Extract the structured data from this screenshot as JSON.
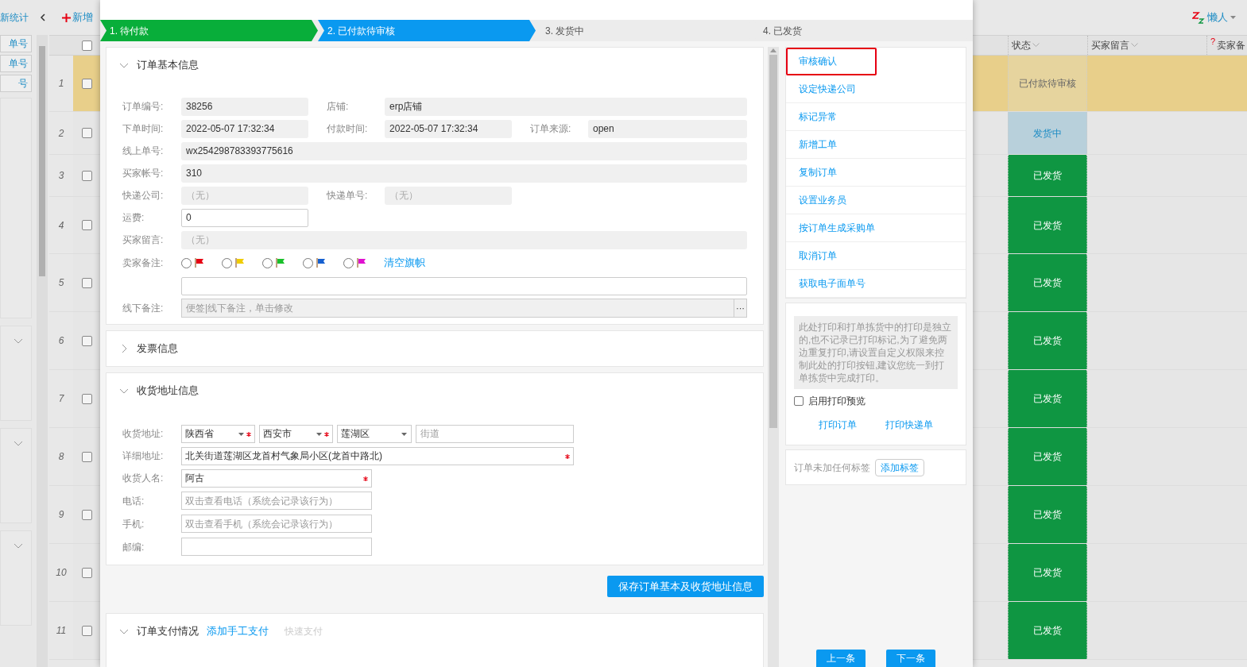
{
  "sidebar": {
    "title": "新统计",
    "fields": [
      "单号",
      "单号",
      "号"
    ]
  },
  "toolbar": {
    "add_button": "新增",
    "lazy_menu": "懒人"
  },
  "table": {
    "all_checked": false,
    "columns": [
      {
        "label": "状态"
      },
      {
        "label": "买家留言"
      },
      {
        "label": "卖家备",
        "help": "?"
      }
    ],
    "rows": [
      {
        "number": "1",
        "selected": true,
        "checked": false,
        "status": "已付款待审核",
        "kind": "pending"
      },
      {
        "number": "2",
        "selected": false,
        "checked": false,
        "status": "发货中",
        "kind": "shipping"
      },
      {
        "number": "3",
        "selected": false,
        "checked": false,
        "status": "已发货",
        "kind": "shipped"
      },
      {
        "number": "4",
        "selected": false,
        "checked": false,
        "status": "已发货",
        "kind": "shipped"
      },
      {
        "number": "5",
        "selected": false,
        "checked": false,
        "status": "已发货",
        "kind": "shipped"
      },
      {
        "number": "6",
        "selected": false,
        "checked": false,
        "status": "已发货",
        "kind": "shipped"
      },
      {
        "number": "7",
        "selected": false,
        "checked": false,
        "status": "已发货",
        "kind": "shipped"
      },
      {
        "number": "8",
        "selected": false,
        "checked": false,
        "status": "已发货",
        "kind": "shipped"
      },
      {
        "number": "9",
        "selected": false,
        "checked": false,
        "status": "已发货",
        "kind": "shipped"
      },
      {
        "number": "10",
        "selected": false,
        "checked": false,
        "status": "已发货",
        "kind": "shipped"
      },
      {
        "number": "11",
        "selected": false,
        "checked": false,
        "status": "已发货",
        "kind": "shipped"
      }
    ]
  },
  "modal": {
    "steps": [
      {
        "label": "1. 待付款",
        "kind": "done"
      },
      {
        "label": "2. 已付款待审核",
        "kind": "current"
      },
      {
        "label": "3. 发货中",
        "kind": "todo"
      },
      {
        "label": "4. 已发货",
        "kind": "todo"
      }
    ],
    "basic_info": {
      "title": "订单基本信息",
      "expanded": true,
      "order_no": {
        "label": "订单编号:",
        "value": "38256"
      },
      "shop": {
        "label": "店铺:",
        "value": "erp店铺"
      },
      "order_time": {
        "label": "下单时间:",
        "value": "2022-05-07 17:32:34"
      },
      "pay_time": {
        "label": "付款时间:",
        "value": "2022-05-07 17:32:34"
      },
      "source": {
        "label": "订单来源:",
        "value": "open"
      },
      "online_no": {
        "label": "线上单号:",
        "value": "wx254298783393775616"
      },
      "buyer_account": {
        "label": "买家帐号:",
        "value": "310"
      },
      "courier": {
        "label": "快递公司:",
        "placeholder": "（无）"
      },
      "tracking_no": {
        "label": "快递单号:",
        "placeholder": "（无）"
      },
      "freight": {
        "label": "运费:",
        "value": "0"
      },
      "buyer_message": {
        "label": "买家留言:",
        "placeholder": "（无）"
      },
      "seller_note": {
        "label": "卖家备注:",
        "flags": [
          {
            "color": "#e60012",
            "selected": false
          },
          {
            "color": "#f0cc00",
            "selected": false
          },
          {
            "color": "#19c02a",
            "selected": false
          },
          {
            "color": "#1560d0",
            "selected": false
          },
          {
            "color": "#e010d0",
            "selected": false
          }
        ],
        "clear_link": "清空旗帜"
      },
      "offline_note": {
        "label": "线下备注:",
        "placeholder": "便签|线下备注，单击修改",
        "more": "···"
      }
    },
    "invoice": {
      "title": "发票信息",
      "expanded": false
    },
    "address": {
      "title": "收货地址信息",
      "expanded": true,
      "region": {
        "label": "收货地址:",
        "province": {
          "value": "陕西省",
          "required": true
        },
        "city": {
          "value": "西安市",
          "required": true
        },
        "district": {
          "value": "莲湖区",
          "required": false
        },
        "street": {
          "placeholder": "街道"
        }
      },
      "detail": {
        "label": "详细地址:",
        "value": "北关街道莲湖区龙首村气象局小区(龙首中路北)",
        "required": true
      },
      "name": {
        "label": "收货人名:",
        "value": "阿古",
        "required": true
      },
      "phone": {
        "label": "电话:",
        "placeholder": "双击查看电话（系统会记录该行为）"
      },
      "mobile": {
        "label": "手机:",
        "placeholder": "双击查看手机（系统会记录该行为）"
      },
      "zip": {
        "label": "邮编:"
      }
    },
    "save_button": "保存订单基本及收货地址信息",
    "payment": {
      "title": "订单支付情况",
      "expanded": true,
      "add_link": "添加手工支付",
      "quick_link": {
        "label": "快速支付",
        "disabled": true
      }
    },
    "actions": [
      {
        "label": "审核确认",
        "highlighted": true
      },
      {
        "label": "设定快递公司",
        "highlighted": false
      },
      {
        "label": "标记异常",
        "highlighted": false
      },
      {
        "label": "新增工单",
        "highlighted": false
      },
      {
        "label": "复制订单",
        "highlighted": false
      },
      {
        "label": "设置业务员",
        "highlighted": false
      },
      {
        "label": "按订单生成采购单",
        "highlighted": false
      },
      {
        "label": "取消订单",
        "highlighted": false
      },
      {
        "label": "获取电子面单号",
        "highlighted": false
      }
    ],
    "print": {
      "note": "此处打印和打单拣货中的打印是独立的,也不记录已打印标记,为了避免两边重复打印,请设置自定义权限来控制此处的打印按钮,建议您统一到打单拣货中完成打印。",
      "preview": {
        "label": "启用打印预览",
        "checked": false
      },
      "buttons": [
        "打印订单",
        "打印快递单"
      ]
    },
    "tags": {
      "text": "订单未加任何标签",
      "add_button": "添加标签"
    },
    "nav": [
      "上一条",
      "下一条"
    ]
  }
}
